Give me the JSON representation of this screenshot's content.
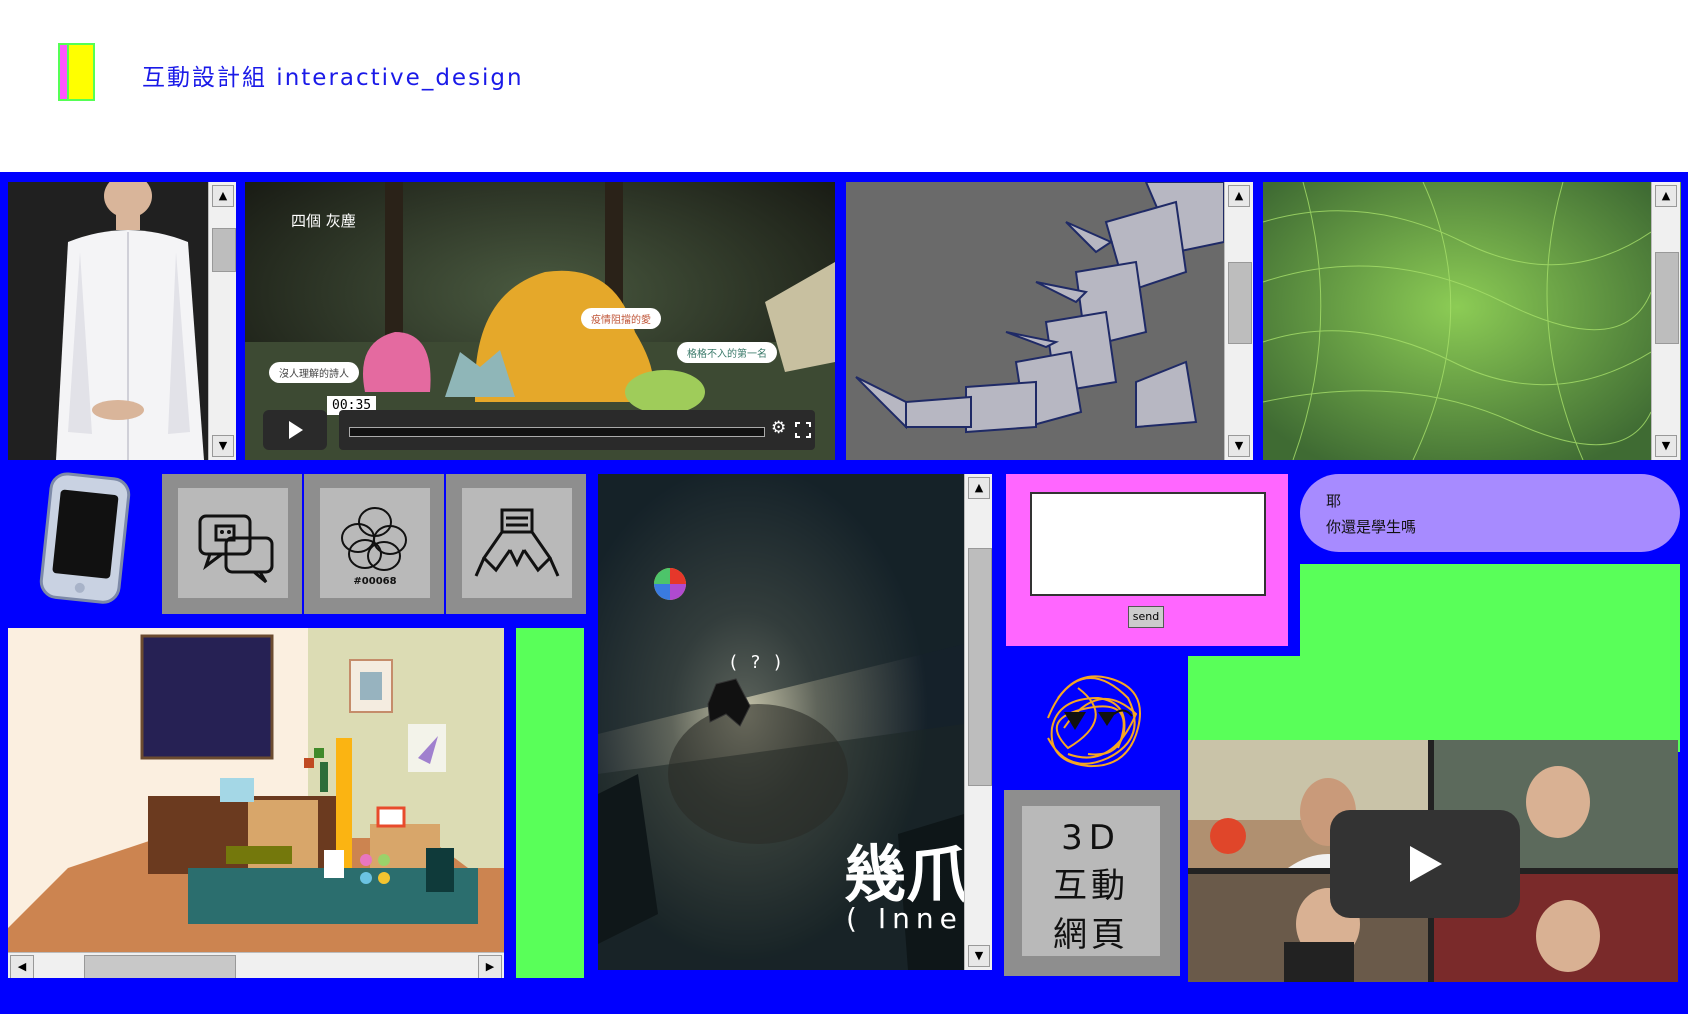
{
  "header": {
    "title": "互動設計組  interactive_design",
    "logo_colors": {
      "back": "#ff55ff",
      "front": "#ffff00",
      "edge": "#55ff55"
    }
  },
  "colors": {
    "board": "#0000ff",
    "green": "#59ff59",
    "magenta": "#ff66ff",
    "lavender": "#a78bff"
  },
  "video": {
    "caption": "四個 灰塵",
    "time": "00:35",
    "bubbles": [
      "疫情阻擋的愛",
      "格格不入的第一名",
      "沒人理解的詩人"
    ]
  },
  "keycaps": [
    {
      "icon": "chat-robot-icon"
    },
    {
      "icon": "scribble-flower-icon",
      "label": "#00068"
    },
    {
      "icon": "hands-stack-icon"
    }
  ],
  "game": {
    "hint": "( ? )",
    "title": "幾爪",
    "subtitle": "( Inner"
  },
  "chat": {
    "send_label": "send",
    "message_line1": "耶",
    "message_line2": "你還是學生嗎"
  },
  "key3d": {
    "line1": "3D",
    "line2": "互動",
    "line3": "網頁"
  }
}
